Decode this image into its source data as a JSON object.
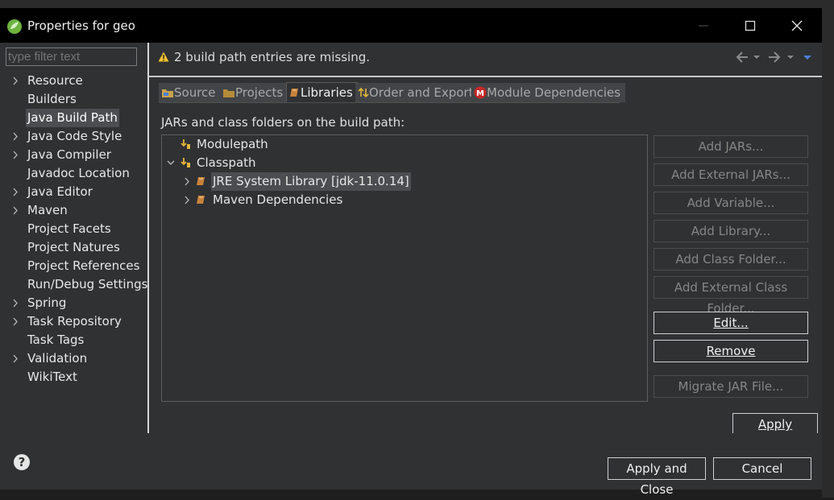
{
  "window": {
    "title": "Properties for geo",
    "minimize": "—",
    "maximize": "☐",
    "close": "✕"
  },
  "filter": {
    "placeholder": "type filter text"
  },
  "sidebar": {
    "items": [
      {
        "label": "Resource",
        "expandable": true
      },
      {
        "label": "Builders",
        "expandable": false
      },
      {
        "label": "Java Build Path",
        "expandable": false,
        "selected": true
      },
      {
        "label": "Java Code Style",
        "expandable": true
      },
      {
        "label": "Java Compiler",
        "expandable": true
      },
      {
        "label": "Javadoc Location",
        "expandable": false
      },
      {
        "label": "Java Editor",
        "expandable": true
      },
      {
        "label": "Maven",
        "expandable": true
      },
      {
        "label": "Project Facets",
        "expandable": false
      },
      {
        "label": "Project Natures",
        "expandable": false
      },
      {
        "label": "Project References",
        "expandable": false
      },
      {
        "label": "Run/Debug Settings",
        "expandable": false
      },
      {
        "label": "Spring",
        "expandable": true
      },
      {
        "label": "Task Repository",
        "expandable": true
      },
      {
        "label": "Task Tags",
        "expandable": false
      },
      {
        "label": "Validation",
        "expandable": true
      },
      {
        "label": "WikiText",
        "expandable": false
      }
    ]
  },
  "message": {
    "text": "2 build path entries are missing.",
    "icon": "warning-icon"
  },
  "tabs": [
    {
      "label": "Source",
      "icon": "source-folder-icon"
    },
    {
      "label": "Projects",
      "icon": "projects-icon"
    },
    {
      "label": "Libraries",
      "icon": "libraries-icon",
      "active": true
    },
    {
      "label": "Order and Export",
      "icon": "order-icon"
    },
    {
      "label": "Module Dependencies",
      "icon": "module-icon"
    }
  ],
  "build_path": {
    "label": "JARs and class folders on the build path:",
    "tree": {
      "modulepath": "Modulepath",
      "classpath": "Classpath",
      "jre": "JRE System Library [jdk-11.0.14]",
      "maven": "Maven Dependencies"
    }
  },
  "buttons": {
    "add_jars": "Add JARs...",
    "add_external_jars": "Add External JARs...",
    "add_variable": "Add Variable...",
    "add_library": "Add Library...",
    "add_class_folder": "Add Class Folder...",
    "add_external_class_folder": "Add External Class Folder...",
    "edit": "Edit...",
    "remove": "Remove",
    "migrate_jar": "Migrate JAR File...",
    "apply": "Apply",
    "apply_and_close": "Apply and Close",
    "cancel": "Cancel"
  },
  "help": "?",
  "colors": {
    "accent_blue": "#4d7fd9",
    "warning": "#f2c12e",
    "module_red": "#c62828",
    "spring_green": "#6db33f"
  }
}
